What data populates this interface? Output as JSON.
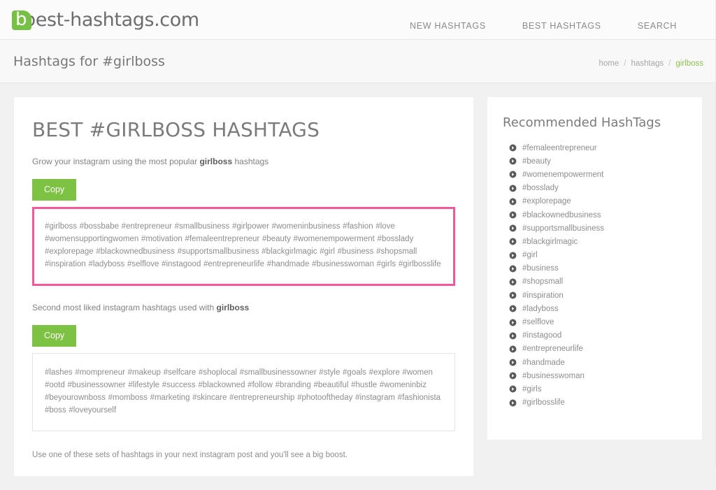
{
  "header": {
    "logo_text": "best-hashtags.com",
    "logo_letter": "b",
    "nav": [
      {
        "label": "NEW HASHTAGS",
        "name": "nav-new-hashtags"
      },
      {
        "label": "BEST HASHTAGS",
        "name": "nav-best-hashtags"
      },
      {
        "label": "SEARCH",
        "name": "nav-search"
      }
    ],
    "brand_green": "#76c043"
  },
  "title_bar": {
    "page_title": "Hashtags for #girlboss",
    "breadcrumb": {
      "home": "home",
      "sep": "/",
      "hashtags": "hashtags",
      "current": "girlboss"
    }
  },
  "main": {
    "heading": "BEST #GIRLBOSS HASHTAGS",
    "lead_prefix": "Grow your instagram using the most popular ",
    "lead_bold": "girlboss",
    "lead_suffix": " hashtags",
    "copy_label_1": "Copy",
    "copy_label_2": "Copy",
    "hashtags_block_1": "#girlboss #bossbabe #entrepreneur #smallbusiness #girlpower #womeninbusiness #fashion #love #womensupportingwomen #motivation #femaleentrepreneur #beauty #womenempowerment #bosslady #explorepage #blackownedbusiness #supportsmallbusiness #blackgirlmagic #girl #business #shopsmall #inspiration #ladyboss #selflove #instagood #entrepreneurlife #handmade #businesswoman #girls #girlbosslife",
    "mid_note_prefix": "Second most liked instagram hashtags used with ",
    "mid_note_bold": "girlboss",
    "hashtags_block_2": "#lashes #mompreneur #makeup #selfcare #shoplocal #smallbusinessowner #style #goals #explore #women #ootd #businessowner #lifestyle #success #blackowned #follow #branding #beautiful #hustle #womeninbiz #beyourownboss #momboss #marketing #skincare #entrepreneurship #photooftheday #instagram #fashionista #boss #loveyourself",
    "bottom_note": "Use one of these sets of hashtags in your next instagram post and you'll see a big boost.",
    "highlight_color": "#f4579a",
    "button_color": "#7dc242"
  },
  "sidebar": {
    "title": "Recommended HashTags",
    "items": [
      {
        "label": "#femaleentrepreneur"
      },
      {
        "label": "#beauty"
      },
      {
        "label": "#womenempowerment"
      },
      {
        "label": "#bosslady"
      },
      {
        "label": "#explorepage"
      },
      {
        "label": "#blackownedbusiness"
      },
      {
        "label": "#supportsmallbusiness"
      },
      {
        "label": "#blackgirlmagic"
      },
      {
        "label": "#girl"
      },
      {
        "label": "#business"
      },
      {
        "label": "#shopsmall"
      },
      {
        "label": "#inspiration"
      },
      {
        "label": "#ladyboss"
      },
      {
        "label": "#selflove"
      },
      {
        "label": "#instagood"
      },
      {
        "label": "#entrepreneurlife"
      },
      {
        "label": "#handmade"
      },
      {
        "label": "#businesswoman"
      },
      {
        "label": "#girls"
      },
      {
        "label": "#girlbosslife"
      }
    ]
  }
}
